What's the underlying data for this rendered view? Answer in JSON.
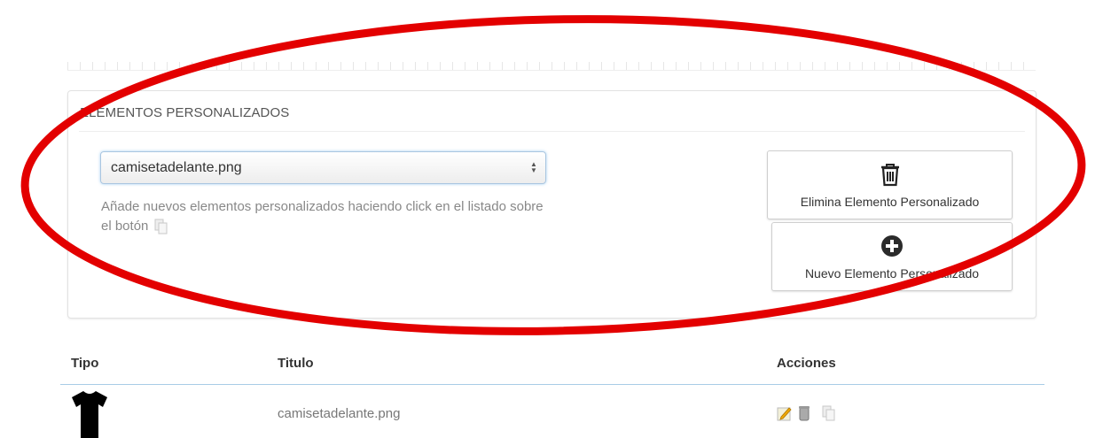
{
  "panel": {
    "title": "ELEMENTOS PERSONALIZADOS",
    "select": {
      "selected": "camisetadelante.png"
    },
    "help_text": "Añade nuevos elementos personalizados haciendo click en el listado sobre el botón",
    "buttons": {
      "delete": {
        "label": "Elimina Elemento Personalizado",
        "icon": "trash-icon"
      },
      "new": {
        "label": "Nuevo Elemento Personalizado",
        "icon": "plus-circle-icon"
      }
    }
  },
  "table": {
    "headers": {
      "tipo": "Tipo",
      "titulo": "Titulo",
      "acciones": "Acciones"
    },
    "rows": [
      {
        "tipo_icon": "tshirt-icon",
        "titulo": "camisetadelante.png",
        "actions": [
          "edit-icon",
          "delete-icon",
          "copy-icon"
        ]
      }
    ]
  },
  "colors": {
    "annotation": "#e30000",
    "accent_line": "#a8cce6"
  }
}
